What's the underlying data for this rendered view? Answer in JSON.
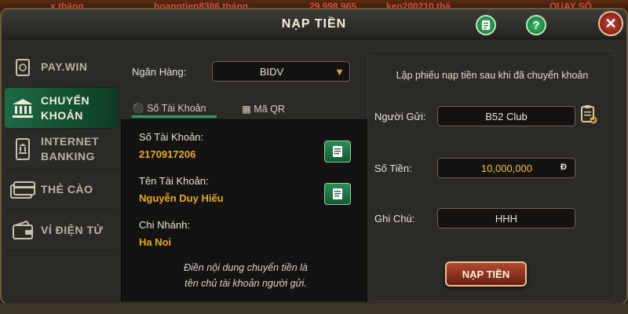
{
  "ticker": {
    "items": [
      "x tháng",
      "hoangtien8386 tháng",
      "29.998.965",
      "keo200210 thá"
    ],
    "quay_label": "QUAY SỐ"
  },
  "dialog": {
    "title": "NẠP TIỀN",
    "help_label": "?",
    "close_label": "✕"
  },
  "sidebar": {
    "items": [
      {
        "label": "PAY.WIN",
        "icon": "wallet-card-icon",
        "active": false
      },
      {
        "label": "CHUYỂN KHOẢN",
        "line1": "CHUYỂN",
        "line2": "KHOẢN",
        "icon": "bank-icon",
        "active": true
      },
      {
        "label": "INTERNET BANKING",
        "line1": "INTERNET",
        "line2": "BANKING",
        "icon": "phone-bank-icon",
        "active": false
      },
      {
        "label": "THẺ CÀO",
        "icon": "scratch-card-icon",
        "active": false
      },
      {
        "label": "VÍ ĐIỆN TỬ",
        "icon": "e-wallet-icon",
        "active": false
      }
    ]
  },
  "transfer": {
    "bank_label": "Ngân Hàng:",
    "bank_selected": "BIDV",
    "tabs": [
      {
        "label": "Số Tài Khoản",
        "icon": "user-icon",
        "active": true
      },
      {
        "label": "Mã QR",
        "icon": "qr-code-icon",
        "active": false
      }
    ],
    "account_number_label": "Số Tài Khoản:",
    "account_number": "2170917206",
    "account_name_label": "Tên Tài Khoản:",
    "account_name": "Nguyễn Duy Hiếu",
    "branch_label": "Chi Nhánh:",
    "branch": "Ha Noi",
    "note_line1": "Điền nội dung chuyển tiền là",
    "note_line2": "tên chủ tài khoản người gửi."
  },
  "form": {
    "instruction": "Lập phiếu nạp tiền sau khi đã chuyển khoản",
    "sender_label": "Người Gửi:",
    "sender_value": "B52 Club",
    "amount_label": "Số Tiền:",
    "amount_value": "10,000,000",
    "currency": "Đ",
    "note_label": "Ghi Chú:",
    "note_value": "HHH",
    "submit_label": "NẠP TIỀN"
  },
  "colors": {
    "accent_green": "#1c6b45",
    "value_gold": "#e6a92a",
    "submit_red": "#8c3220"
  }
}
